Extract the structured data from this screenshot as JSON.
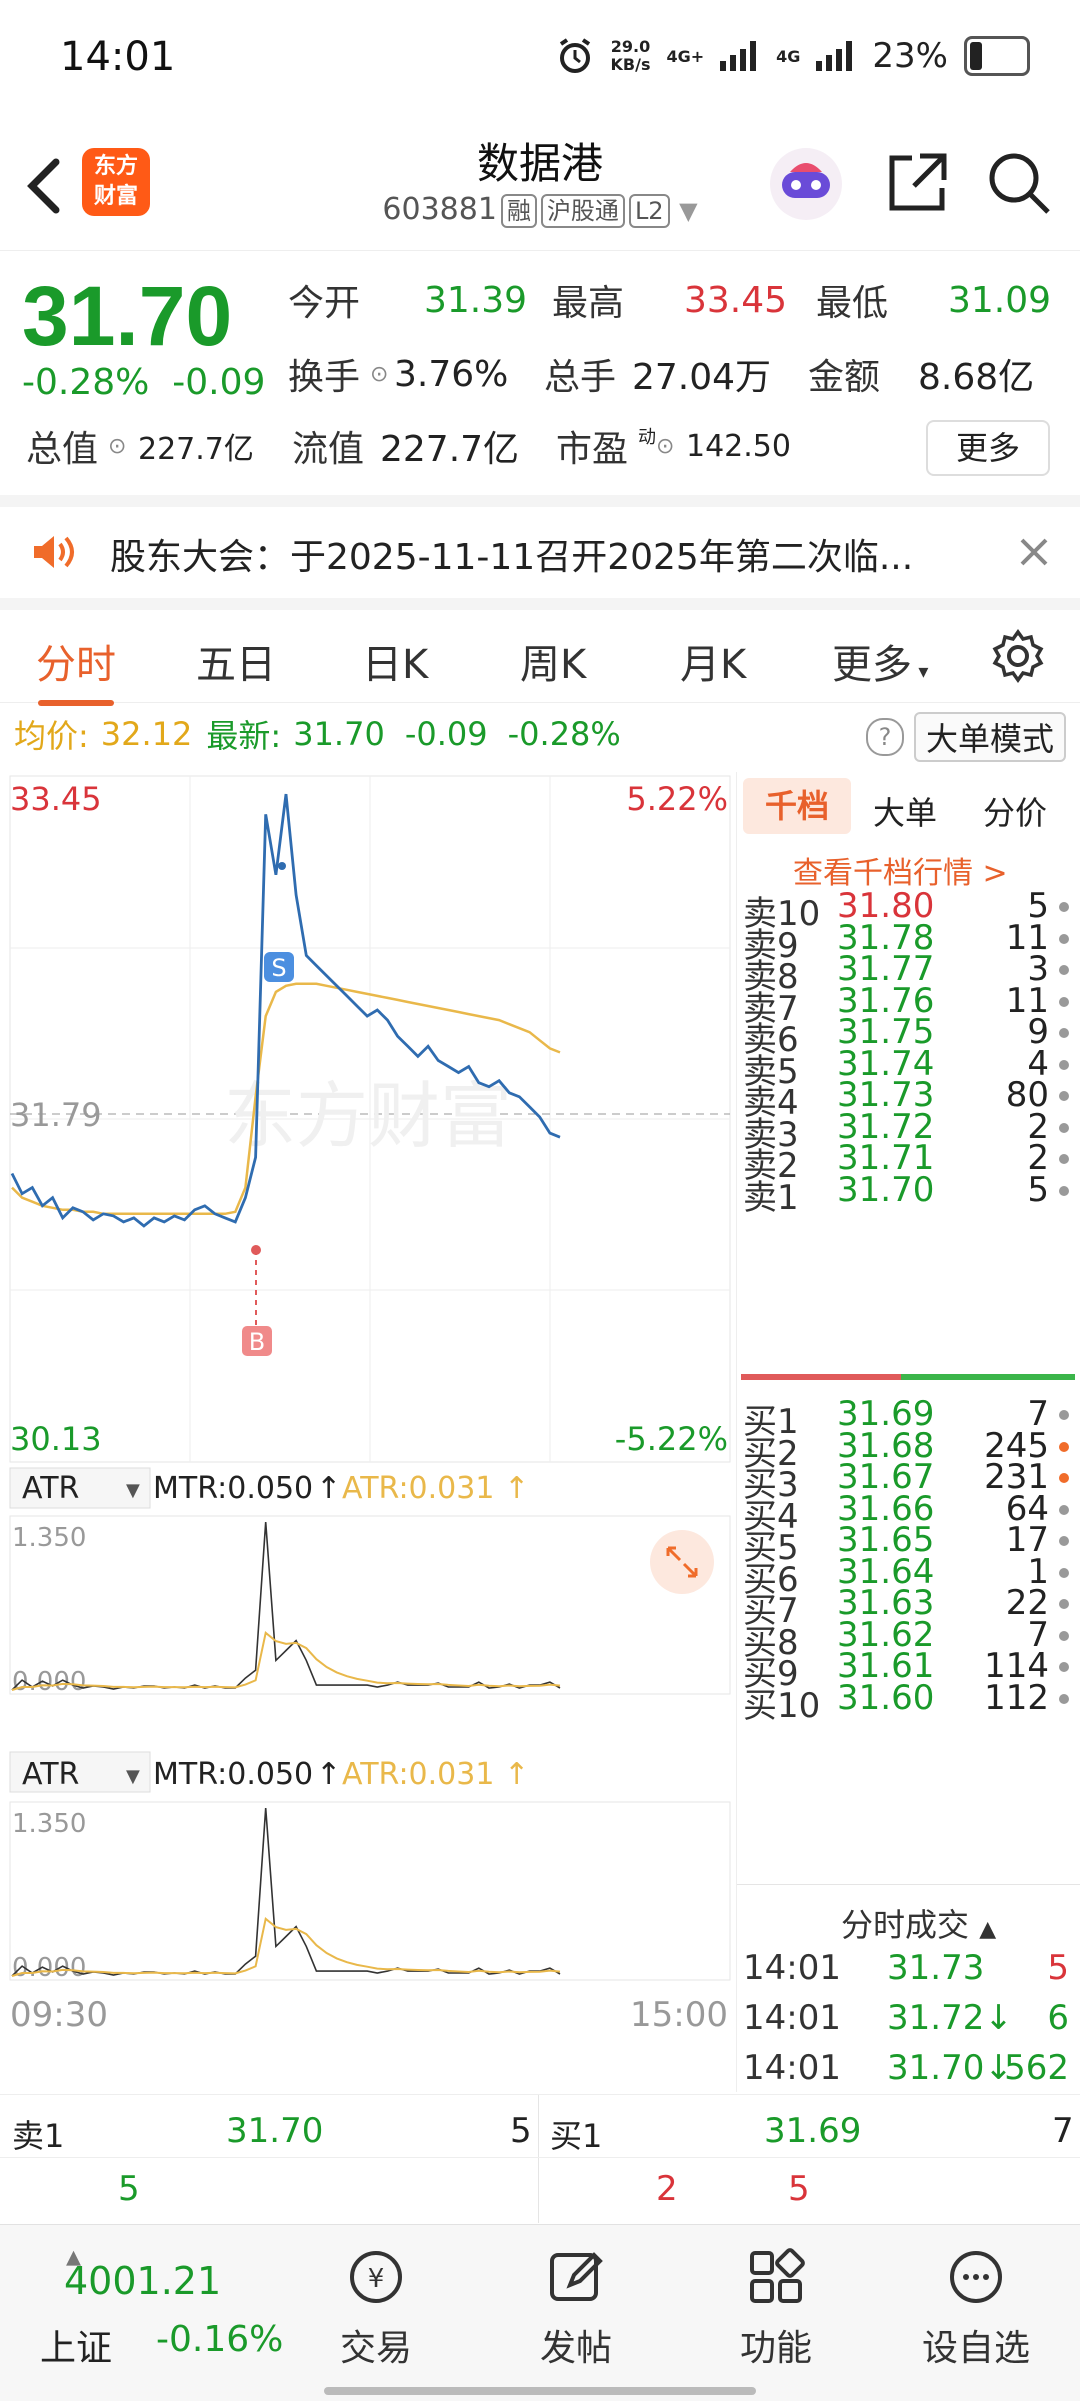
{
  "status_bar": {
    "time": "14:01",
    "net_speed": "29.0",
    "net_unit": "KB/s",
    "sig1": "4G+",
    "sig2": "4G",
    "battery": "23%"
  },
  "header": {
    "title": "数据港",
    "code": "603881",
    "tags": [
      "融",
      "沪股通",
      "L2"
    ],
    "logo_line1": "东方",
    "logo_line2": "财富"
  },
  "quote": {
    "price": "31.70",
    "change_pct": "-0.28%",
    "change": "-0.09",
    "fields": [
      {
        "label": "今开",
        "value": "31.39",
        "color": "green"
      },
      {
        "label": "最高",
        "value": "33.45",
        "color": "red"
      },
      {
        "label": "最低",
        "value": "31.09",
        "color": "green"
      },
      {
        "label": "换手",
        "value": "3.76%",
        "color": "black"
      },
      {
        "label": "总手",
        "value": "27.04万",
        "color": "black"
      },
      {
        "label": "金额",
        "value": "8.68亿",
        "color": "black"
      },
      {
        "label": "总值",
        "value": "227.7亿",
        "color": "black"
      },
      {
        "label": "流值",
        "value": "227.7亿",
        "color": "black"
      },
      {
        "label": "市盈",
        "value": "142.50",
        "color": "black"
      }
    ],
    "pe_sup": "动",
    "more": "更多"
  },
  "notice": {
    "text": "股东大会：于2025-11-11召开2025年第二次临..."
  },
  "tabs": [
    "分时",
    "五日",
    "日K",
    "周K",
    "月K",
    "更多"
  ],
  "avg_line": {
    "avg_label": "均价:",
    "avg": "32.12",
    "latest_label": "最新:",
    "latest": "31.70",
    "chg": "-0.09",
    "pct": "-0.28%",
    "mode": "大单模式"
  },
  "chart": {
    "high": "33.45",
    "low": "30.13",
    "mid": "31.79",
    "high_pct": "5.22%",
    "low_pct": "-5.22%",
    "time_start": "09:30",
    "time_end": "15:00",
    "watermark": "东方财富",
    "sell_marker": "S",
    "buy_marker": "B",
    "indicators": [
      {
        "name": "ATR",
        "mtr": "MTR:0.050",
        "atr": "ATR:0.031",
        "max": "1.350",
        "min": "0.000"
      },
      {
        "name": "ATR",
        "mtr": "MTR:0.050",
        "atr": "ATR:0.031",
        "max": "1.350",
        "min": "0.000"
      }
    ]
  },
  "chart_data": {
    "type": "line",
    "series": [
      {
        "values": [
          31.52,
          31.42,
          31.45,
          31.36,
          31.4,
          31.3,
          31.35,
          31.33,
          31.29,
          31.32,
          31.31,
          31.28,
          31.3,
          31.26,
          31.3,
          31.28,
          31.31,
          31.29,
          31.34,
          31.36,
          31.32,
          31.3,
          31.28,
          31.4,
          31.6,
          33.3,
          33.0,
          33.4,
          32.9,
          32.6,
          32.55,
          32.5,
          32.45,
          32.4,
          32.35,
          32.3,
          32.33,
          32.28,
          32.2,
          32.15,
          32.1,
          32.15,
          32.08,
          32.05,
          32.02,
          32.05,
          31.97,
          31.95,
          31.98,
          31.92,
          31.9,
          31.85,
          31.8,
          31.72,
          31.7
        ]
      },
      {
        "values": [
          31.45,
          31.4,
          31.38,
          31.36,
          31.35,
          31.34,
          31.34,
          31.33,
          31.33,
          31.32,
          31.32,
          31.32,
          31.32,
          31.32,
          31.32,
          31.32,
          31.32,
          31.32,
          31.32,
          31.32,
          31.32,
          31.32,
          31.33,
          31.45,
          31.9,
          32.3,
          32.42,
          32.45,
          32.46,
          32.46,
          32.46,
          32.45,
          32.44,
          32.43,
          32.42,
          32.41,
          32.4,
          32.39,
          32.38,
          32.37,
          32.36,
          32.35,
          32.34,
          32.33,
          32.32,
          32.31,
          32.3,
          32.29,
          32.28,
          32.26,
          32.24,
          32.22,
          32.18,
          32.14,
          32.12
        ]
      }
    ],
    "ylim": [
      30.13,
      33.45
    ]
  },
  "book_tabs": [
    "千档",
    "大单",
    "分价"
  ],
  "book_link": "查看千档行情 >",
  "sells": [
    {
      "l": "卖10",
      "p": "31.80",
      "v": "5"
    },
    {
      "l": "卖9",
      "p": "31.78",
      "v": "11"
    },
    {
      "l": "卖8",
      "p": "31.77",
      "v": "3"
    },
    {
      "l": "卖7",
      "p": "31.76",
      "v": "11"
    },
    {
      "l": "卖6",
      "p": "31.75",
      "v": "9"
    },
    {
      "l": "卖5",
      "p": "31.74",
      "v": "4"
    },
    {
      "l": "卖4",
      "p": "31.73",
      "v": "80"
    },
    {
      "l": "卖3",
      "p": "31.72",
      "v": "2"
    },
    {
      "l": "卖2",
      "p": "31.71",
      "v": "2"
    },
    {
      "l": "卖1",
      "p": "31.70",
      "v": "5"
    }
  ],
  "buys": [
    {
      "l": "买1",
      "p": "31.69",
      "v": "7"
    },
    {
      "l": "买2",
      "p": "31.68",
      "v": "245"
    },
    {
      "l": "买3",
      "p": "31.67",
      "v": "231"
    },
    {
      "l": "买4",
      "p": "31.66",
      "v": "64"
    },
    {
      "l": "买5",
      "p": "31.65",
      "v": "17"
    },
    {
      "l": "买6",
      "p": "31.64",
      "v": "1"
    },
    {
      "l": "买7",
      "p": "31.63",
      "v": "22"
    },
    {
      "l": "买8",
      "p": "31.62",
      "v": "7"
    },
    {
      "l": "买9",
      "p": "31.61",
      "v": "114"
    },
    {
      "l": "买10",
      "p": "31.60",
      "v": "112"
    }
  ],
  "ticks_title": "分时成交",
  "ticks": [
    {
      "t": "14:01",
      "p": "31.73",
      "v": "5",
      "arrow": ""
    },
    {
      "t": "14:01",
      "p": "31.72↓",
      "v": "6",
      "arrow": "down"
    },
    {
      "t": "14:01",
      "p": "31.70↓",
      "v": "562",
      "arrow": "down"
    }
  ],
  "bid_ask": {
    "sell_label": "卖1",
    "sell_price": "31.70",
    "sell_vol": "5",
    "buy_label": "买1",
    "buy_price": "31.69",
    "buy_vol": "7",
    "sub_left": "5",
    "sub_mid": "2",
    "sub_right": "5"
  },
  "nav": {
    "index_value": "4001.21",
    "index_name": "上证",
    "index_pct": "-0.16%",
    "items": [
      "交易",
      "发帖",
      "功能",
      "设自选"
    ]
  }
}
